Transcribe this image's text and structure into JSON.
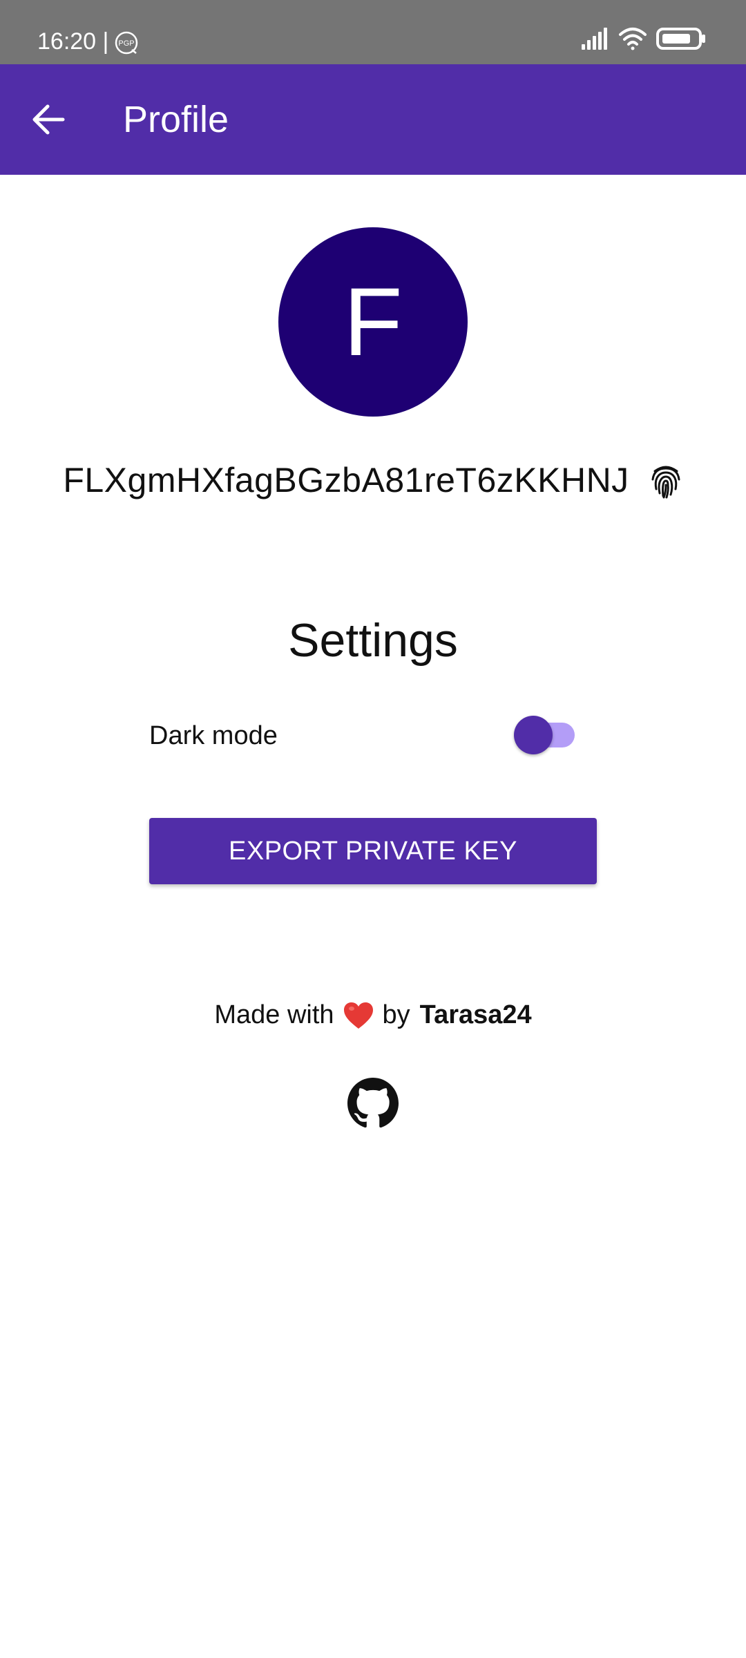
{
  "status_bar": {
    "time": "16:20 |",
    "icons": [
      "pgp-icon",
      "signal-icon",
      "wifi-icon",
      "battery-icon"
    ]
  },
  "app_bar": {
    "title": "Profile",
    "back_icon": "arrow-back-icon",
    "color": "#512DA8"
  },
  "profile": {
    "avatar_letter": "F",
    "avatar_color": "#1E0073",
    "public_key": "FLXgmHXfagBGzbA81reT6zKKHNJ",
    "key_icon": "fingerprint-icon"
  },
  "settings": {
    "title": "Settings",
    "dark_mode_label": "Dark mode",
    "dark_mode_on": true,
    "export_button_label": "EXPORT PRIVATE KEY"
  },
  "footer": {
    "made_with": "Made with",
    "by": "by",
    "author": "Tarasa24",
    "heart_icon": "heart-icon",
    "github_icon": "github-icon"
  }
}
